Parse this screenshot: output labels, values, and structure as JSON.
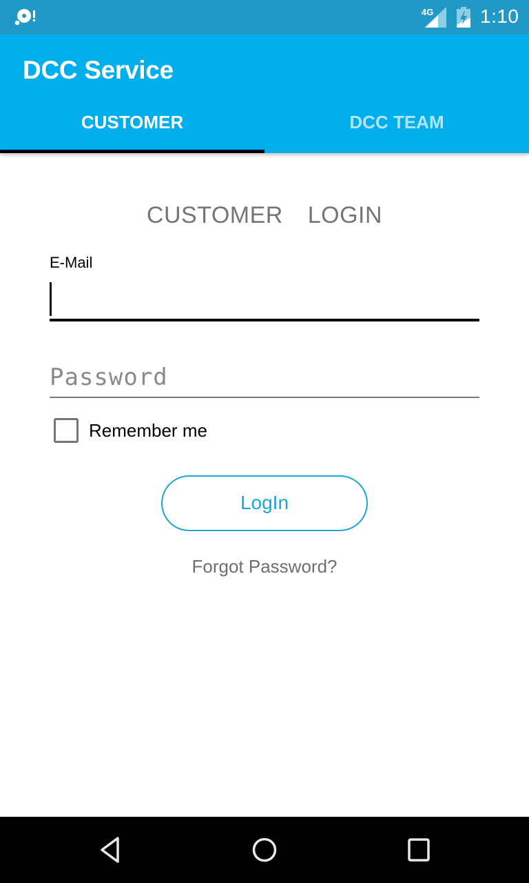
{
  "status_bar": {
    "left_icon": "disc-alert-icon",
    "network_label": "4G",
    "signal_icon": "signal-icon",
    "battery_icon": "battery-charging-icon",
    "time": "1:10"
  },
  "app_bar": {
    "title": "DCC Service",
    "background_color": "#00aeec",
    "tabs": [
      {
        "label": "CUSTOMER",
        "selected": true
      },
      {
        "label": "DCC TEAM",
        "selected": false
      }
    ],
    "indicator_color": "#000000"
  },
  "login_form": {
    "heading": "CUSTOMER  LOGIN",
    "email": {
      "label": "E-Mail",
      "value": "",
      "focused": true
    },
    "password": {
      "placeholder": "Password",
      "value": ""
    },
    "remember_me": {
      "label": "Remember me",
      "checked": false
    },
    "login_button": {
      "label": "LogIn",
      "color": "#1aa7d8"
    },
    "forgot_password_link": "Forgot Password?"
  },
  "nav_bar": {
    "back": "back-icon",
    "home": "home-icon",
    "recents": "recents-icon"
  }
}
